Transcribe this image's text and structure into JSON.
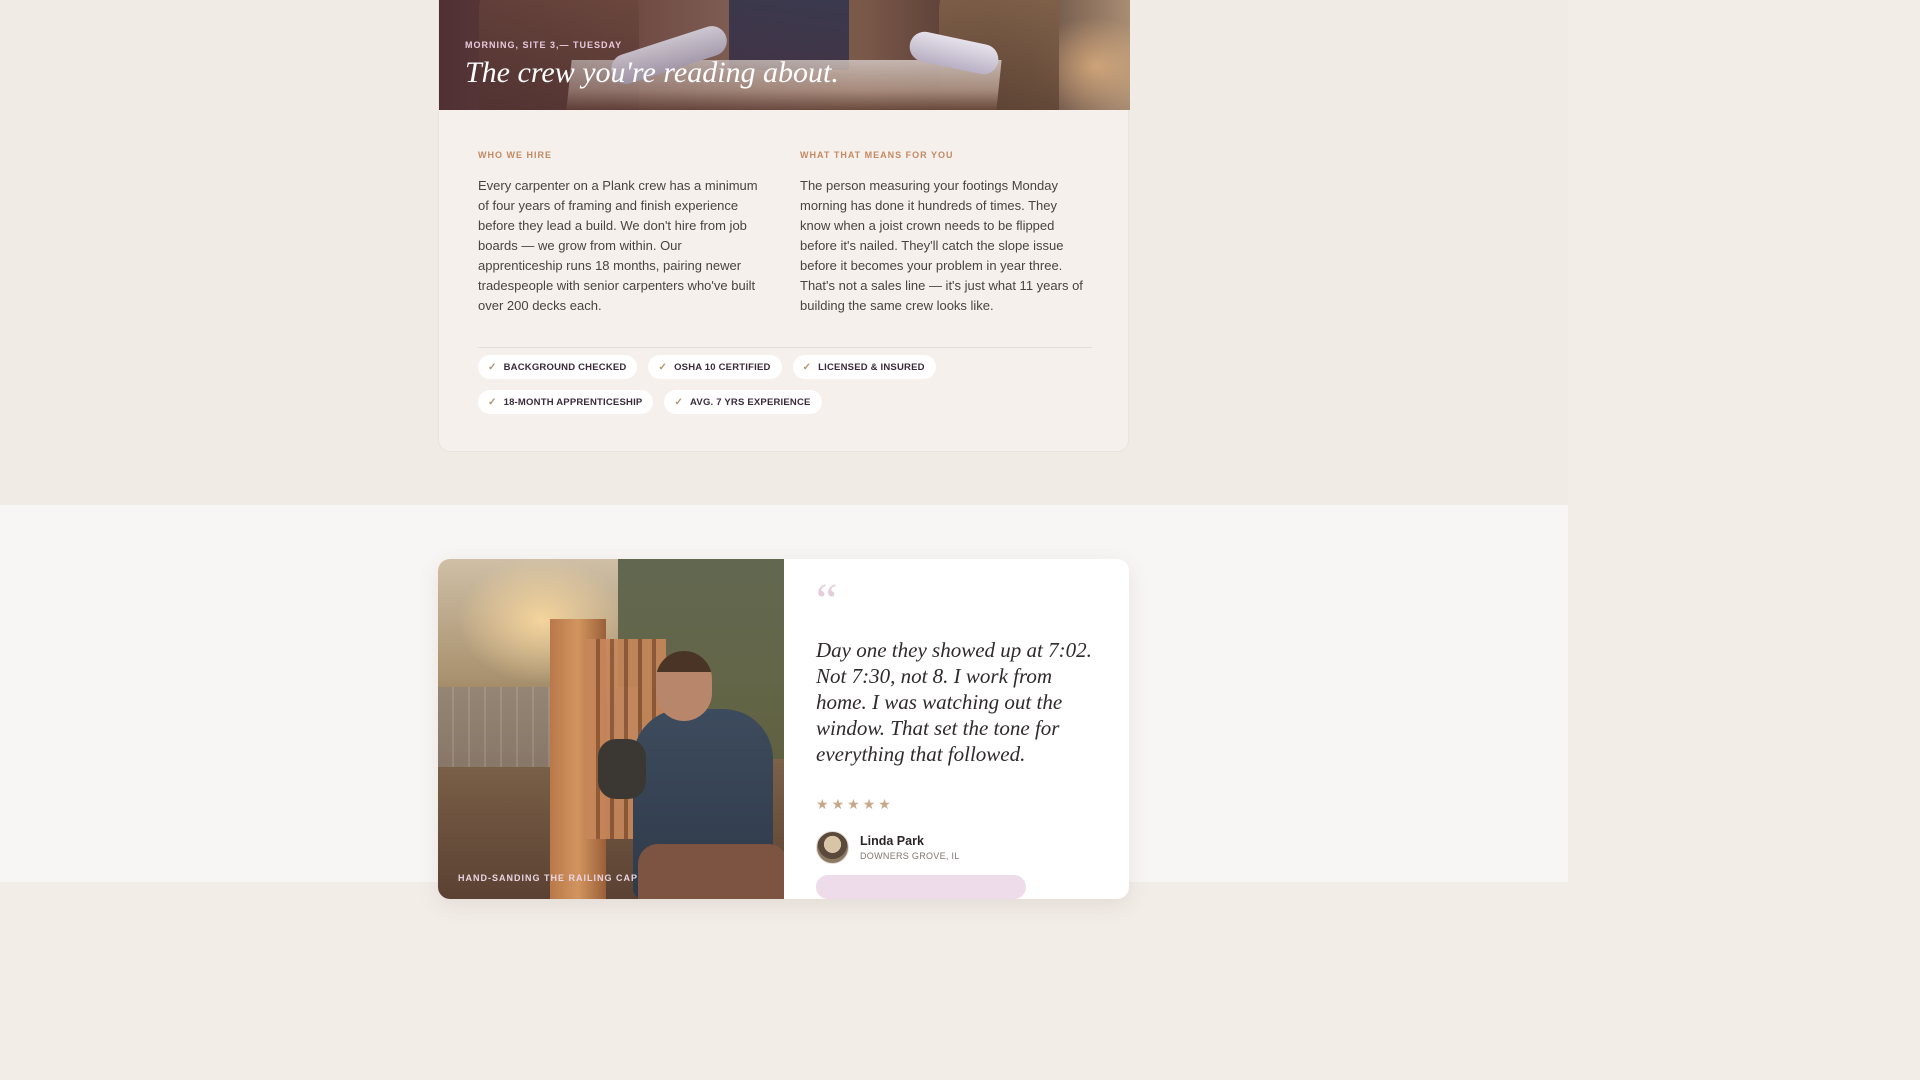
{
  "crew": {
    "hero_kicker": "MORNING, SITE 3,— TUESDAY",
    "hero_title": "The crew you're reading about.",
    "left": {
      "label": "WHO WE HIRE",
      "text": "Every carpenter on a Plank crew has a minimum of four years of framing and finish experience before they lead a build. We don't hire from job boards — we grow from within. Our apprenticeship runs 18 months, pairing newer tradespeople with senior carpenters who've built over 200 decks each."
    },
    "right": {
      "label": "WHAT THAT MEANS FOR YOU",
      "text": "The person measuring your footings Monday morning has done it hundreds of times. They know when a joist crown needs to be flipped before it's nailed. They'll catch the slope issue before it becomes your problem in year three. That's not a sales line — it's just what 11 years of building the same crew looks like."
    },
    "badges": [
      {
        "check": "✓",
        "label": "BACKGROUND CHECKED"
      },
      {
        "check": "✓",
        "label": "OSHA 10 CERTIFIED"
      },
      {
        "check": "✓",
        "label": "LICENSED & INSURED"
      },
      {
        "check": "✓",
        "label": "18-MONTH APPRENTICESHIP"
      },
      {
        "check": "✓",
        "label": "AVG. 7 YRS EXPERIENCE"
      }
    ]
  },
  "testimonial": {
    "photo_caption": "HAND-SANDING THE RAILING CAP",
    "quote_mark": "“",
    "quote": "Day one they showed up at 7:02. Not 7:30, not 8. I work from home. I was watching out the window. That set the tone for everything that followed.",
    "rating": 5,
    "star_glyph": "★",
    "name": "Linda Park",
    "location": "DOWNERS GROVE, IL"
  },
  "colors": {
    "accent_label": "#c38a63",
    "kicker_pink": "#e8c9dd",
    "star": "#c6a889"
  }
}
